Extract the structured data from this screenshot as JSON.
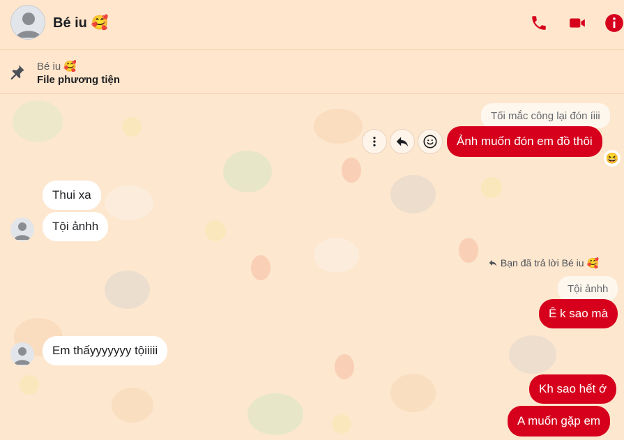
{
  "header": {
    "name": "Bé iu 🥰"
  },
  "pinned": {
    "sender": "Bé iu 🥰",
    "text": "File phương tiện"
  },
  "messages": {
    "quoted_1": "Tối mắc công lại đón íiii",
    "out_1": "Ảnh muốn đón em đồ thôi",
    "reaction_1": "😆",
    "in_1": "Thui xa",
    "in_2": "Tội ảnhh",
    "reply_note": "Bạn đã trả lời Bé iu 🥰",
    "quoted_2": "Tội ảnhh",
    "out_2": "Ê k sao mà",
    "in_3": "Em thấyyyyyyy tộiiiii",
    "out_3": "Kh sao hết ớ",
    "out_4": "A muốn gặp em"
  },
  "icons": [
    "phone-icon",
    "video-icon",
    "info-icon",
    "pin-icon",
    "more-icon",
    "reply-icon",
    "emoji-icon"
  ],
  "colors": {
    "accent": "#d6001c",
    "background": "#fde7cf"
  }
}
